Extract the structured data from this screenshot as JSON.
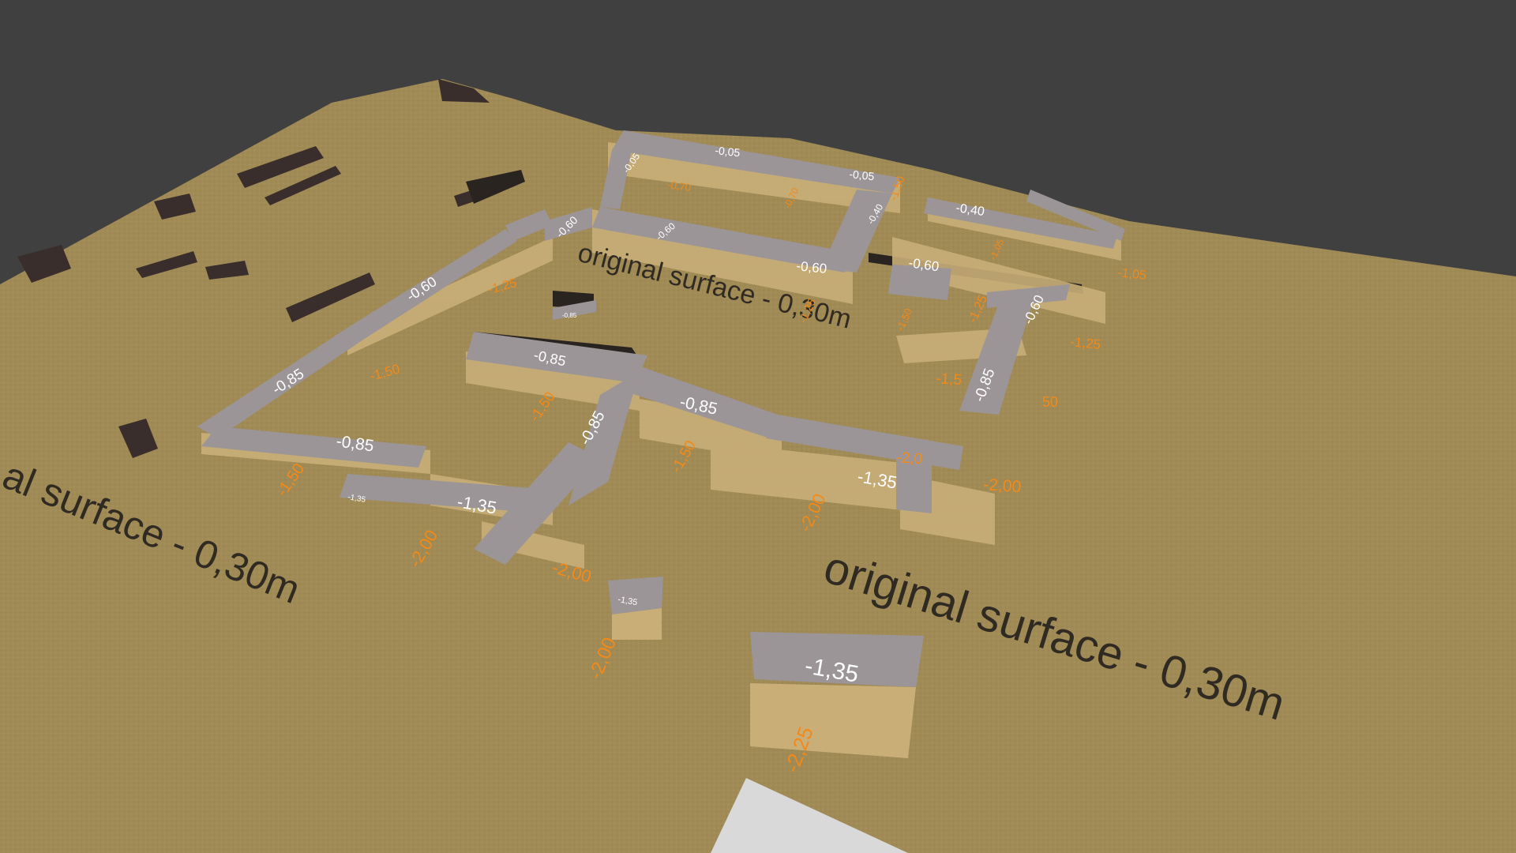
{
  "scene": {
    "colors": {
      "background": "#404040",
      "ground": "#a08a55",
      "foundation_top": "#9b9598",
      "foundation_side": "#c9ae78",
      "wall_dark": "#3a2e2c",
      "surface_label": "#2f2a22",
      "top_label": "#ffffff",
      "depth_label": "#f28a1a",
      "panel": "#d9d9d9"
    },
    "surface_labels": [
      "original surface - 0,30m",
      "al surface - 0,30m",
      "original surface - 0,30m"
    ],
    "top_labels": [
      "-0,05",
      "-0,05",
      "-0,05",
      "-0,40",
      "-0,40",
      "-0,60",
      "-0,60",
      "-0,60",
      "-0,60",
      "-0,60",
      "-0,60",
      "-0,85",
      "-0,85",
      "-0,85",
      "-0,85",
      "-0,85",
      "-0,85",
      "-1,35",
      "-1,35",
      "-1,35",
      "-1,35",
      "-1,35",
      "-0,85"
    ],
    "depth_labels": [
      "-0,70",
      "-0,70",
      "-1,05",
      "-1,05",
      "-1,25",
      "-1,25",
      "-1,25",
      "-1,25",
      "-1,50",
      "-1,50",
      "-1,50",
      "-1,50",
      "-1,50",
      "-1,5",
      "-2,0",
      "-2,00",
      "-2,00",
      "-2,00",
      "-2,00",
      "-2,00",
      "-2,25",
      "-1,50",
      "50",
      "-1,5"
    ]
  }
}
